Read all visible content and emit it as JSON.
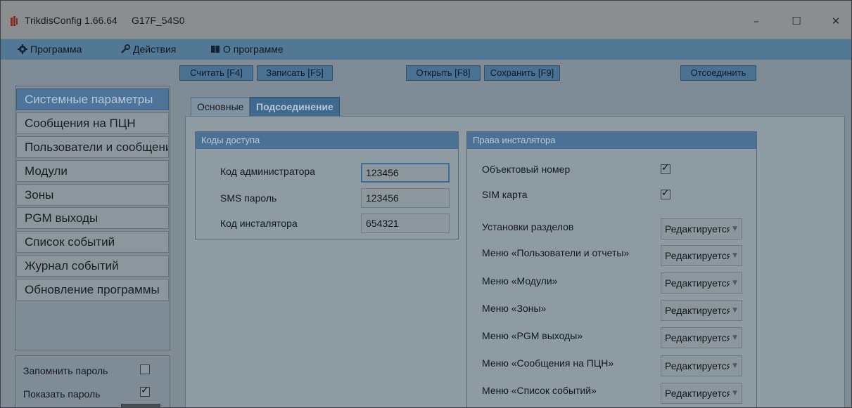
{
  "window": {
    "title": "TrikdisConfig 1.66.64",
    "device": "G17F_54S0",
    "minimize": "–",
    "maximize": "☐",
    "close": "✕"
  },
  "menu": {
    "program": "Программа",
    "actions": "Действия",
    "about": "О программе"
  },
  "toolbar": {
    "read": "Считать [F4]",
    "write": "Записать [F5]",
    "open": "Открыть [F8]",
    "save": "Сохранить [F9]",
    "disconnect": "Отсоединить"
  },
  "sidebar": {
    "items": [
      {
        "label": "Системные параметры"
      },
      {
        "label": "Сообщения на ПЦН"
      },
      {
        "label": "Пользователи и сообщения"
      },
      {
        "label": "Модули"
      },
      {
        "label": "Зоны"
      },
      {
        "label": "PGM выходы"
      },
      {
        "label": "Список событий"
      },
      {
        "label": "Журнал событий"
      },
      {
        "label": "Обновление программы"
      }
    ],
    "active_index": 0
  },
  "options": {
    "remember_password": {
      "label": "Запомнить пароль",
      "checked": false
    },
    "show_password": {
      "label": "Показать пароль",
      "checked": true
    }
  },
  "tabs": {
    "basic": "Основные",
    "connection": "Подсоединение"
  },
  "access_codes": {
    "header": "Коды доступа",
    "admin": {
      "label": "Код администратора",
      "value": "123456"
    },
    "sms": {
      "label": "SMS пароль",
      "value": "123456"
    },
    "installer": {
      "label": "Код инсталятора",
      "value": "654321"
    }
  },
  "installer_rights": {
    "header": "Права инсталятора",
    "object_number": {
      "label": "Объектовый номер",
      "checked": true
    },
    "sim_card": {
      "label": "SIM карта",
      "checked": true
    },
    "rows": [
      {
        "label": "Установки разделов",
        "value": "Редактируется"
      },
      {
        "label": "Меню «Пользователи и отчеты»",
        "value": "Редактируется"
      },
      {
        "label": "Меню «Модули»",
        "value": "Редактируется"
      },
      {
        "label": "Меню «Зоны»",
        "value": "Редактируется"
      },
      {
        "label": "Меню «PGM выходы»",
        "value": "Редактируется"
      },
      {
        "label": "Меню «Сообщения на ПЦН»",
        "value": "Редактируется"
      },
      {
        "label": "Меню «Список событий»",
        "value": "Редактируется"
      }
    ]
  },
  "icons": {
    "app": "trikdis-logo-icon",
    "program": "gear-icon",
    "actions": "wrench-icon",
    "about": "book-icon",
    "dropdown": "chevron-down-icon",
    "check": "checkmark-icon"
  },
  "colors": {
    "accent": "#4b7295",
    "menubar": "#527893",
    "active_sidebar": "#4c7599"
  }
}
